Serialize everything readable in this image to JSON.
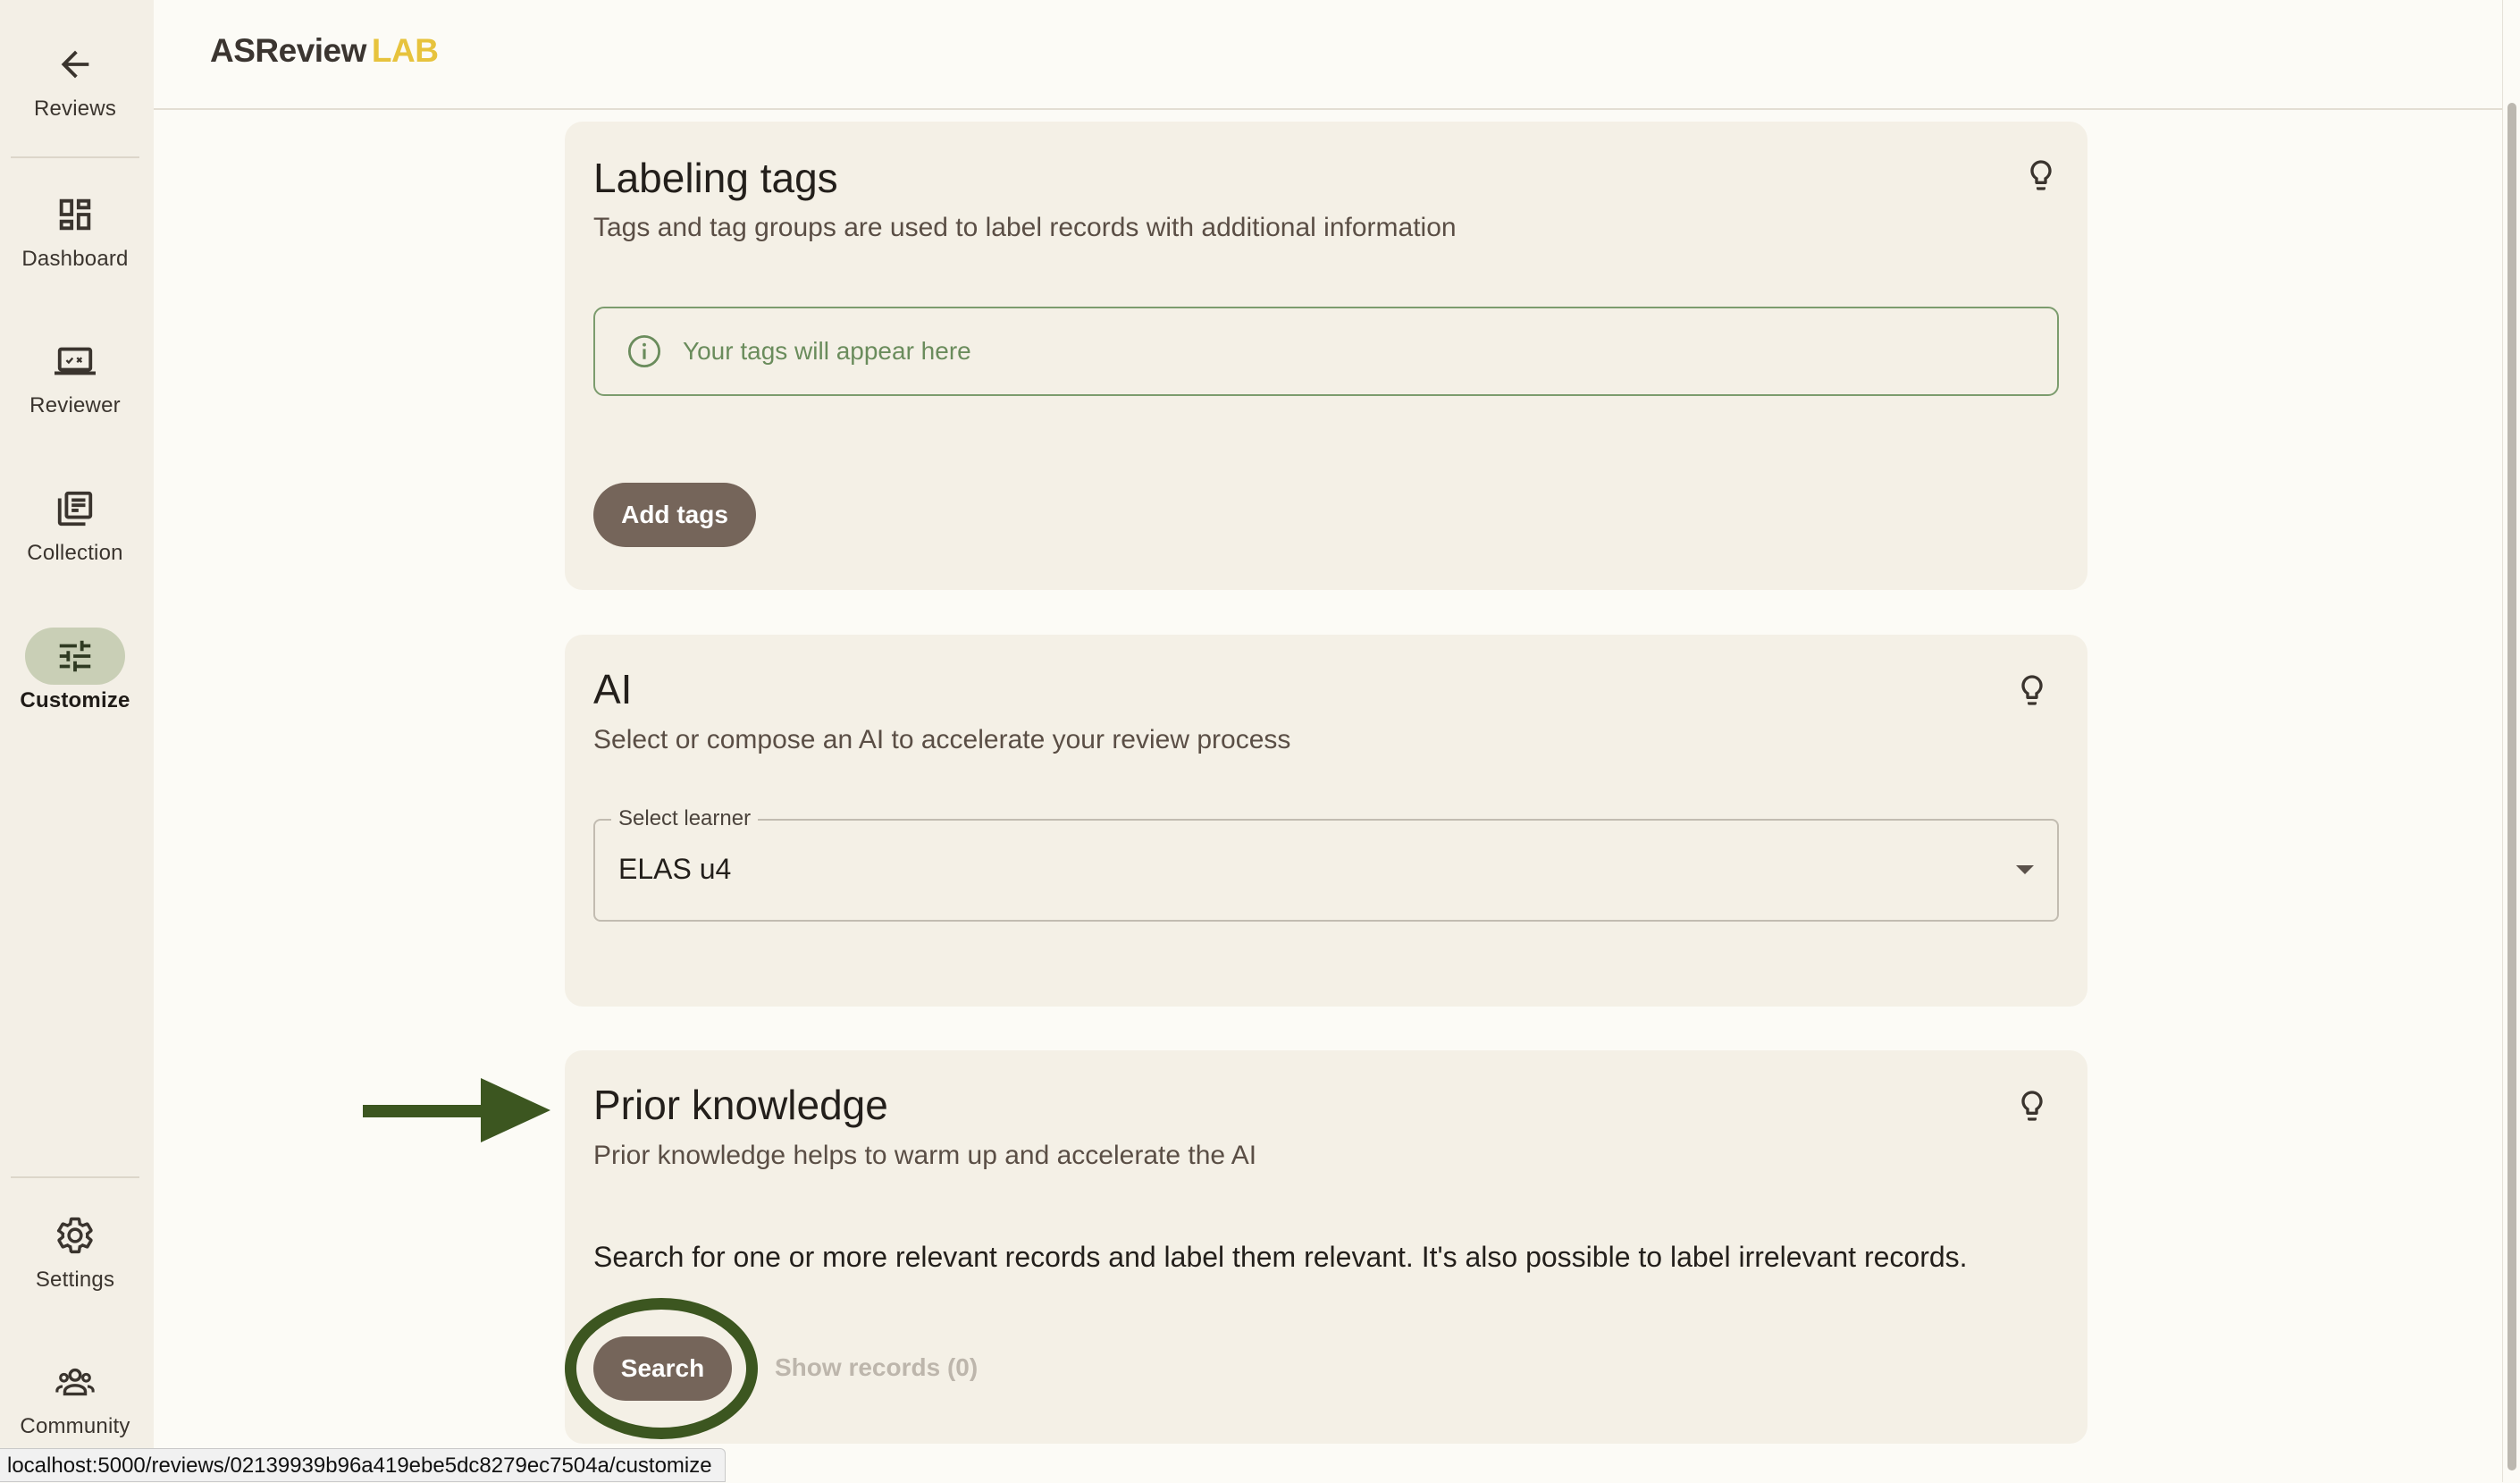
{
  "app": {
    "logo_main": "ASReview",
    "logo_lab": "LAB"
  },
  "sidebar": {
    "items": [
      {
        "label": "Reviews",
        "icon": "arrow-left-icon"
      },
      {
        "label": "Dashboard",
        "icon": "dashboard-icon"
      },
      {
        "label": "Reviewer",
        "icon": "reviewer-icon"
      },
      {
        "label": "Collection",
        "icon": "collection-icon"
      },
      {
        "label": "Customize",
        "icon": "tune-icon",
        "active": true
      },
      {
        "label": "Settings",
        "icon": "gear-icon"
      },
      {
        "label": "Community",
        "icon": "community-icon"
      }
    ]
  },
  "cards": {
    "labeling_tags": {
      "title": "Labeling tags",
      "subtitle": "Tags and tag groups are used to label records with additional information",
      "info_text": "Your tags will appear here",
      "add_button": "Add tags"
    },
    "ai": {
      "title": "AI",
      "subtitle": "Select or compose an AI to accelerate your review process",
      "select_label": "Select learner",
      "select_value": "ELAS u4"
    },
    "prior_knowledge": {
      "title": "Prior knowledge",
      "subtitle": "Prior knowledge helps to warm up and accelerate the AI",
      "description": "Search for one or more relevant records and label them relevant. It's also possible to label irrelevant records.",
      "search_button": "Search",
      "show_records": "Show records (0)"
    }
  },
  "status_bar": {
    "url": "localhost:5000/reviews/02139939b96a419ebe5dc8279ec7504a/customize"
  },
  "colors": {
    "accent_button": "#75655a",
    "annotation_green": "#3c5620",
    "logo_lab": "#e7c33d",
    "active_nav": "#c9cfb6"
  }
}
